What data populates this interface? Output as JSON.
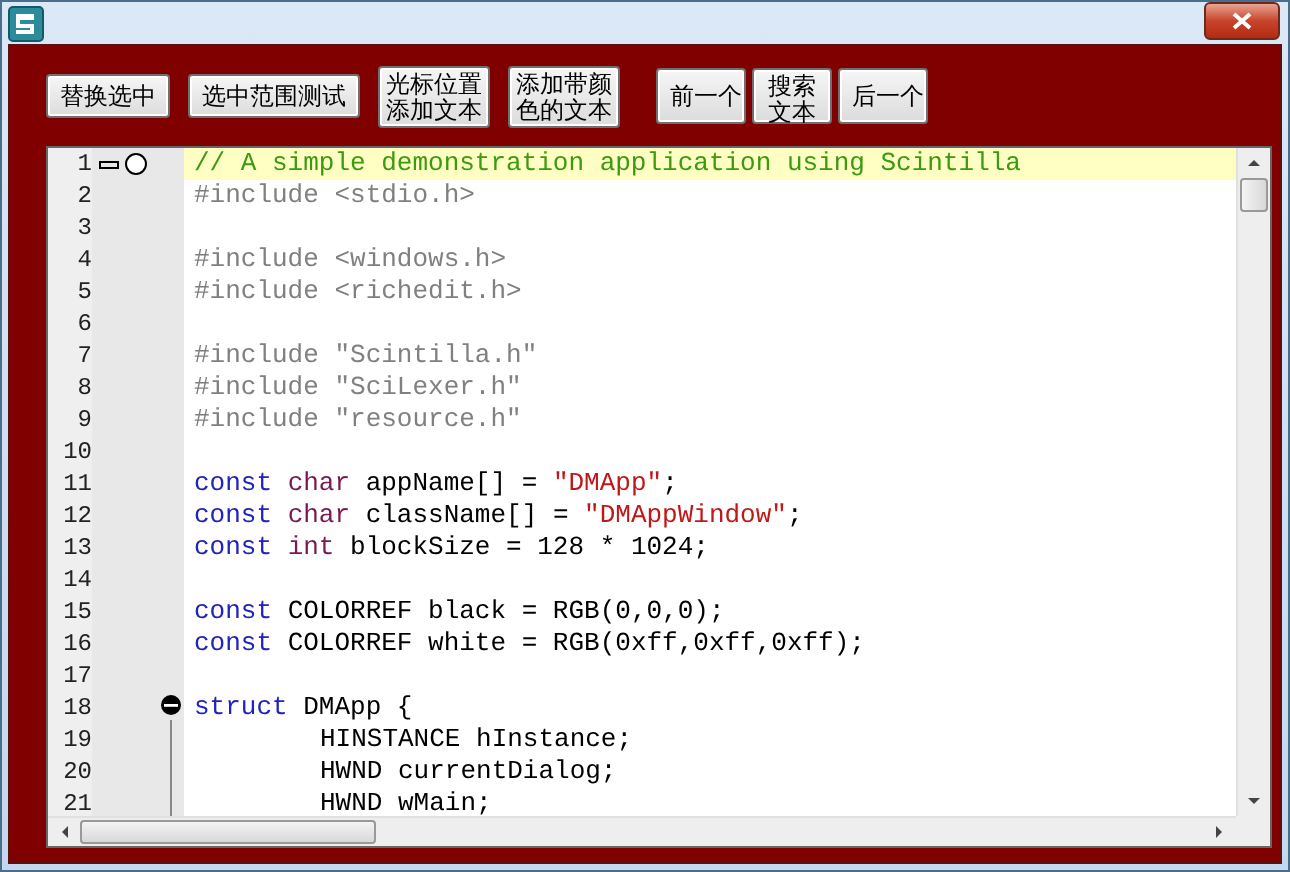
{
  "toolbar": {
    "actions": [
      {
        "label": "替换选中",
        "tall": false
      },
      {
        "label": "选中范围测试",
        "tall": false
      },
      {
        "label": "光标位置添加文本",
        "tall": true
      },
      {
        "label": "添加带颜色的文本",
        "tall": true
      }
    ],
    "navigation": [
      {
        "label": "前一个",
        "tall": false
      },
      {
        "label": "搜索文本",
        "tall": true
      },
      {
        "label": "后一个",
        "tall": false
      }
    ]
  },
  "editor": {
    "lines": [
      {
        "number": "1",
        "current": true,
        "bookmark": true,
        "tokens": [
          {
            "kind": "comment",
            "text": "// A simple demonstration application using Scintilla"
          }
        ]
      },
      {
        "number": "2",
        "tokens": [
          {
            "kind": "preprocessor",
            "text": "#include <stdio.h>"
          }
        ]
      },
      {
        "number": "3"
      },
      {
        "number": "4",
        "tokens": [
          {
            "kind": "preprocessor",
            "text": "#include <windows.h>"
          }
        ]
      },
      {
        "number": "5",
        "tokens": [
          {
            "kind": "preprocessor",
            "text": "#include <richedit.h>"
          }
        ]
      },
      {
        "number": "6"
      },
      {
        "number": "7",
        "tokens": [
          {
            "kind": "preprocessor",
            "text": "#include \"Scintilla.h\""
          }
        ]
      },
      {
        "number": "8",
        "tokens": [
          {
            "kind": "preprocessor",
            "text": "#include \"SciLexer.h\""
          }
        ]
      },
      {
        "number": "9",
        "tokens": [
          {
            "kind": "preprocessor",
            "text": "#include \"resource.h\""
          }
        ]
      },
      {
        "number": "10"
      },
      {
        "number": "11",
        "tokens": [
          {
            "kind": "keyword",
            "text": "const"
          },
          {
            "kind": "type",
            "text": "char"
          },
          {
            "kind": "plain",
            "text": "appName[] ="
          },
          {
            "kind": "string",
            "text": "\"DMApp\""
          },
          {
            "kind": "glue",
            "text": ";"
          }
        ]
      },
      {
        "number": "12",
        "tokens": [
          {
            "kind": "keyword",
            "text": "const"
          },
          {
            "kind": "type",
            "text": "char"
          },
          {
            "kind": "plain",
            "text": "className[] ="
          },
          {
            "kind": "string",
            "text": "\"DMAppWindow\""
          },
          {
            "kind": "glue",
            "text": ";"
          }
        ]
      },
      {
        "number": "13",
        "tokens": [
          {
            "kind": "keyword",
            "text": "const"
          },
          {
            "kind": "type",
            "text": "int"
          },
          {
            "kind": "plain",
            "text": "blockSize = 128 * 1024;"
          }
        ]
      },
      {
        "number": "14"
      },
      {
        "number": "15",
        "tokens": [
          {
            "kind": "keyword",
            "text": "const"
          },
          {
            "kind": "plain",
            "text": "COLORREF black = RGB(0,0,0);"
          }
        ]
      },
      {
        "number": "16",
        "tokens": [
          {
            "kind": "keyword",
            "text": "const"
          },
          {
            "kind": "plain",
            "text": "COLORREF white = RGB(0xff,0xff,0xff);"
          }
        ]
      },
      {
        "number": "17"
      },
      {
        "number": "18",
        "fold_head": true,
        "tokens": [
          {
            "kind": "keyword",
            "text": "struct"
          },
          {
            "kind": "plain",
            "text": "DMApp {"
          }
        ]
      },
      {
        "number": "19",
        "in_fold": true,
        "indented": true,
        "tokens": [
          {
            "kind": "plain",
            "text": "HINSTANCE hInstance;"
          }
        ]
      },
      {
        "number": "20",
        "in_fold": true,
        "indented": true,
        "tokens": [
          {
            "kind": "plain",
            "text": "HWND currentDialog;"
          }
        ]
      },
      {
        "number": "21",
        "in_fold": true,
        "indented": true,
        "tokens": [
          {
            "kind": "plain",
            "text": "HWND wMain;"
          }
        ]
      }
    ]
  }
}
